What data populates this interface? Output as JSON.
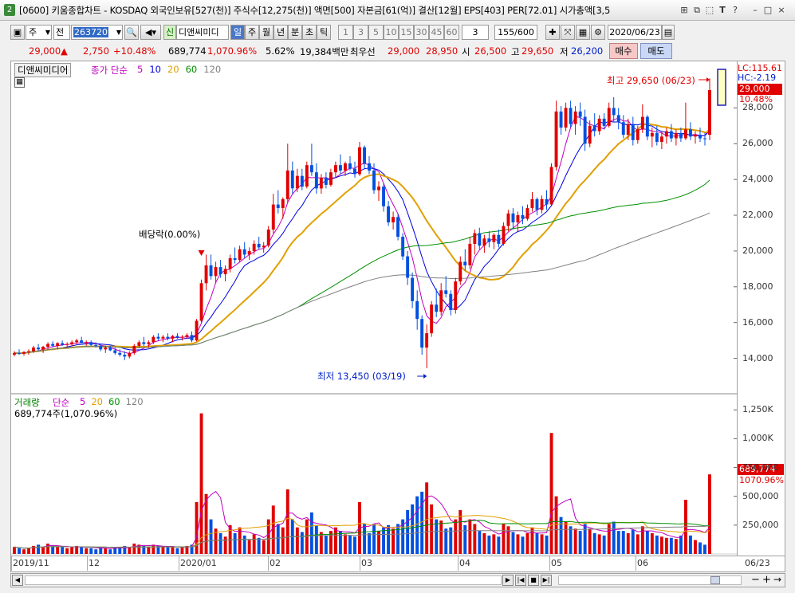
{
  "window": {
    "number": "2",
    "title": "[0600] 키움종합차트 - KOSDAQ 외국인보유[527(천)] 주식수[12,275(천)] 액면[500] 자본금[61(억)] 결산[12월] EPS[403] PER[72.01] 시가총액[3,5"
  },
  "toolbar": {
    "period_select": "주",
    "type_select": "전",
    "stock_code": "263720",
    "credit_badge": "신",
    "stock_name": "디앤씨미디",
    "periods": [
      "일",
      "주",
      "월",
      "년",
      "분",
      "초",
      "틱"
    ],
    "active_period": "일",
    "intervals": [
      "1",
      "3",
      "5",
      "10",
      "15",
      "30",
      "45",
      "60"
    ],
    "interval_value": "3",
    "count": "155/600",
    "date": "2020/06/23"
  },
  "info": {
    "price": "29,000",
    "change_arrow": "▲",
    "change": "2,750",
    "change_pct": "+10.48%",
    "volume": "689,774",
    "volume_pct": "1,070.96%",
    "turnover": "5.62%",
    "amount": "19,384백만",
    "best_label": "최우선",
    "ask": "29,000",
    "bid": "28,950",
    "open_label": "시",
    "open": "26,500",
    "high_label": "고",
    "high": "29,650",
    "low_label": "저",
    "low": "26,200",
    "buy_button": "매수",
    "sell_button": "매도"
  },
  "price_panel": {
    "stock_label": "디앤씨미디어",
    "ma_label": "종가 단순",
    "ma_periods": [
      "5",
      "10",
      "20",
      "60",
      "120"
    ],
    "ma_colors": [
      "#c000c0",
      "#0000e0",
      "#e0a000",
      "#009000",
      "#808080"
    ],
    "lc_label": "LC:115.61",
    "hc_label": "HC:-2.19",
    "current_price_tag": "29,000",
    "current_pct_tag": "10.48%",
    "high_annotation": "최고 29,650 (06/23)",
    "low_annotation": "최저 13,450 (03/19)",
    "dividend_annotation": "배당락(0.00%)",
    "y_ticks": [
      "28,000",
      "26,000",
      "24,000",
      "22,000",
      "20,000",
      "18,000",
      "16,000",
      "14,000"
    ]
  },
  "volume_panel": {
    "label": "거래량",
    "ma_label": "단순",
    "ma_periods": [
      "5",
      "20",
      "60",
      "120"
    ],
    "current_label": "689,774주(1,070.96%)",
    "y_ticks": [
      "1,250K",
      "1,000K",
      "750,000",
      "500,000",
      "250,000"
    ],
    "current_tag": "689,774",
    "current_pct_tag": "1070.96%"
  },
  "x_axis": {
    "labels": [
      "2019/11",
      "12",
      "2020/01",
      "02",
      "03",
      "04",
      "05",
      "06"
    ],
    "end_label": "06/23"
  },
  "chart_data": {
    "type": "candlestick",
    "summary": {
      "high": 29650,
      "high_date": "06/23",
      "low": 13450,
      "low_date": "03/19",
      "last_close": 29000,
      "last_open": 26500,
      "last_high": 29650,
      "last_low": 26200,
      "last_volume": 689774
    },
    "ylim": [
      13000,
      29800
    ],
    "volume_ylim": [
      0,
      1300000
    ],
    "candles": [
      [
        14200,
        14400,
        14100,
        14300,
        60
      ],
      [
        14300,
        14500,
        14200,
        14250,
        50
      ],
      [
        14250,
        14400,
        14150,
        14350,
        40
      ],
      [
        14350,
        14500,
        14200,
        14400,
        55
      ],
      [
        14400,
        14700,
        14300,
        14600,
        70
      ],
      [
        14600,
        14800,
        14400,
        14500,
        80
      ],
      [
        14500,
        14700,
        14300,
        14650,
        60
      ],
      [
        14650,
        14900,
        14500,
        14800,
        90
      ],
      [
        14800,
        14950,
        14600,
        14700,
        70
      ],
      [
        14700,
        14900,
        14500,
        14850,
        60
      ],
      [
        14850,
        15000,
        14700,
        14750,
        60
      ],
      [
        14750,
        14900,
        14600,
        14800,
        50
      ],
      [
        14800,
        15000,
        14700,
        14900,
        60
      ],
      [
        14900,
        15100,
        14800,
        15000,
        70
      ],
      [
        15000,
        15200,
        14850,
        14850,
        60
      ],
      [
        14850,
        15000,
        14700,
        14900,
        50
      ],
      [
        14900,
        15000,
        14700,
        14750,
        50
      ],
      [
        14750,
        14900,
        14600,
        14700,
        40
      ],
      [
        14700,
        14800,
        14400,
        14500,
        60
      ],
      [
        14500,
        14700,
        14300,
        14600,
        50
      ],
      [
        14600,
        14700,
        14400,
        14450,
        40
      ],
      [
        14450,
        14600,
        14200,
        14300,
        60
      ],
      [
        14300,
        14500,
        14100,
        14200,
        50
      ],
      [
        14200,
        14400,
        13900,
        14100,
        70
      ],
      [
        14100,
        14400,
        14000,
        14300,
        60
      ],
      [
        14300,
        14800,
        14200,
        14700,
        90
      ],
      [
        14700,
        15000,
        14600,
        14900,
        80
      ],
      [
        14900,
        15200,
        14700,
        14800,
        70
      ],
      [
        14800,
        15000,
        14600,
        14900,
        60
      ],
      [
        14900,
        15300,
        14800,
        15200,
        80
      ],
      [
        15200,
        15400,
        15000,
        15100,
        70
      ],
      [
        15100,
        15300,
        14900,
        15200,
        60
      ],
      [
        15200,
        15400,
        15000,
        15100,
        60
      ],
      [
        15100,
        15300,
        14900,
        15250,
        60
      ],
      [
        15250,
        15400,
        15100,
        15150,
        50
      ],
      [
        15150,
        15300,
        15000,
        15200,
        60
      ],
      [
        15200,
        15400,
        15100,
        15300,
        70
      ],
      [
        15300,
        15500,
        14900,
        15000,
        80
      ],
      [
        15000,
        16200,
        14950,
        16100,
        450
      ],
      [
        16100,
        18400,
        16000,
        18200,
        1220
      ],
      [
        18200,
        19800,
        17800,
        19200,
        520
      ],
      [
        19200,
        19800,
        18400,
        18600,
        300
      ],
      [
        18600,
        19400,
        18200,
        19100,
        220
      ],
      [
        19100,
        19500,
        18500,
        18700,
        180
      ],
      [
        18700,
        19200,
        18300,
        19000,
        150
      ],
      [
        19000,
        19800,
        18800,
        19600,
        250
      ],
      [
        19600,
        20200,
        19300,
        19500,
        180
      ],
      [
        19500,
        20300,
        19400,
        20100,
        230
      ],
      [
        20100,
        20500,
        19600,
        19800,
        160
      ],
      [
        19800,
        20200,
        19500,
        20000,
        120
      ],
      [
        20000,
        20600,
        19800,
        20400,
        170
      ],
      [
        20400,
        20800,
        20100,
        20200,
        140
      ],
      [
        20200,
        20500,
        19900,
        20300,
        120
      ],
      [
        20300,
        21400,
        20200,
        21200,
        300
      ],
      [
        21200,
        23200,
        21000,
        22600,
        420
      ],
      [
        22600,
        23400,
        22100,
        22400,
        260
      ],
      [
        22400,
        23000,
        21800,
        22900,
        230
      ],
      [
        22900,
        26000,
        22700,
        24500,
        560
      ],
      [
        24500,
        25000,
        23200,
        23500,
        300
      ],
      [
        23500,
        24600,
        23300,
        24200,
        230
      ],
      [
        24200,
        24600,
        23400,
        23600,
        190
      ],
      [
        23600,
        25000,
        23500,
        24800,
        300
      ],
      [
        24800,
        26000,
        24200,
        24400,
        360
      ],
      [
        24400,
        24900,
        23200,
        23500,
        250
      ],
      [
        23500,
        24300,
        23200,
        24100,
        190
      ],
      [
        24100,
        24400,
        23500,
        23700,
        160
      ],
      [
        23700,
        24600,
        23600,
        24400,
        200
      ],
      [
        24400,
        25000,
        24100,
        24800,
        230
      ],
      [
        24800,
        25400,
        24300,
        24500,
        200
      ],
      [
        24500,
        25000,
        24200,
        24900,
        170
      ],
      [
        24900,
        25300,
        24500,
        24600,
        160
      ],
      [
        24600,
        25000,
        24100,
        24300,
        150
      ],
      [
        24300,
        26100,
        24200,
        25800,
        450
      ],
      [
        25800,
        25900,
        24600,
        24900,
        260
      ],
      [
        24900,
        25300,
        24300,
        24500,
        180
      ],
      [
        24500,
        24900,
        23200,
        23400,
        260
      ],
      [
        23400,
        23900,
        22800,
        23600,
        200
      ],
      [
        23600,
        23800,
        22200,
        22500,
        230
      ],
      [
        22500,
        22800,
        21400,
        21600,
        250
      ],
      [
        21600,
        22200,
        21200,
        21900,
        220
      ],
      [
        21900,
        22100,
        20600,
        20800,
        260
      ],
      [
        20800,
        21000,
        19500,
        19700,
        300
      ],
      [
        19700,
        20000,
        18100,
        18500,
        380
      ],
      [
        18500,
        18800,
        16800,
        17200,
        430
      ],
      [
        17200,
        17800,
        15600,
        16200,
        500
      ],
      [
        16200,
        16400,
        14200,
        14600,
        540
      ],
      [
        14600,
        15900,
        13450,
        15400,
        620
      ],
      [
        15400,
        17200,
        15200,
        17000,
        430
      ],
      [
        17000,
        17900,
        16300,
        16600,
        300
      ],
      [
        16600,
        18200,
        16400,
        17800,
        290
      ],
      [
        17800,
        18600,
        17400,
        17600,
        220
      ],
      [
        17600,
        17800,
        16400,
        16700,
        230
      ],
      [
        16700,
        18500,
        16500,
        18300,
        300
      ],
      [
        18300,
        19700,
        18100,
        19400,
        380
      ],
      [
        19400,
        20100,
        18900,
        19200,
        250
      ],
      [
        19200,
        20800,
        19000,
        20400,
        300
      ],
      [
        20400,
        21200,
        19800,
        21000,
        260
      ],
      [
        21000,
        21300,
        20100,
        20300,
        200
      ],
      [
        20300,
        20900,
        19900,
        20700,
        180
      ],
      [
        20700,
        21100,
        20200,
        20500,
        160
      ],
      [
        20500,
        21000,
        20100,
        20900,
        170
      ],
      [
        20900,
        21200,
        20200,
        20400,
        150
      ],
      [
        20400,
        21600,
        20300,
        21400,
        260
      ],
      [
        21400,
        22300,
        21100,
        22100,
        240
      ],
      [
        22100,
        22400,
        21200,
        21600,
        190
      ],
      [
        21600,
        22200,
        21100,
        22000,
        170
      ],
      [
        22000,
        22500,
        21500,
        21800,
        150
      ],
      [
        21800,
        22600,
        21700,
        22400,
        180
      ],
      [
        22400,
        23300,
        22200,
        22900,
        230
      ],
      [
        22900,
        23000,
        22000,
        22300,
        180
      ],
      [
        22300,
        23100,
        22100,
        22900,
        170
      ],
      [
        22900,
        23400,
        22300,
        22600,
        160
      ],
      [
        22600,
        24900,
        22500,
        24700,
        1050
      ],
      [
        24700,
        28400,
        24500,
        27800,
        500
      ],
      [
        27800,
        28100,
        26500,
        26900,
        320
      ],
      [
        26900,
        28300,
        26700,
        28000,
        280
      ],
      [
        28000,
        28400,
        26900,
        27100,
        240
      ],
      [
        27100,
        28100,
        26500,
        27800,
        220
      ],
      [
        27800,
        28300,
        27000,
        27500,
        200
      ],
      [
        27500,
        27900,
        25600,
        26000,
        260
      ],
      [
        26000,
        27300,
        25800,
        27000,
        220
      ],
      [
        27000,
        27700,
        26400,
        26700,
        180
      ],
      [
        26700,
        27600,
        26500,
        27400,
        170
      ],
      [
        27400,
        27700,
        26800,
        27000,
        160
      ],
      [
        27000,
        28300,
        26900,
        28000,
        260
      ],
      [
        28000,
        28600,
        27200,
        27600,
        280
      ],
      [
        27600,
        28000,
        26800,
        27200,
        200
      ],
      [
        27200,
        27600,
        26300,
        26500,
        200
      ],
      [
        26500,
        27400,
        26200,
        27100,
        180
      ],
      [
        27100,
        27500,
        25900,
        26200,
        210
      ],
      [
        26200,
        27000,
        26000,
        26800,
        170
      ],
      [
        26800,
        28200,
        26600,
        27500,
        240
      ],
      [
        27500,
        27600,
        26200,
        26400,
        200
      ],
      [
        26400,
        26900,
        25800,
        26600,
        180
      ],
      [
        26600,
        27000,
        25900,
        26100,
        160
      ],
      [
        26100,
        26700,
        25700,
        26400,
        150
      ],
      [
        26400,
        26900,
        26000,
        26700,
        140
      ],
      [
        26700,
        27100,
        26100,
        26300,
        140
      ],
      [
        26300,
        26800,
        25900,
        26600,
        130
      ],
      [
        26600,
        26900,
        26100,
        26300,
        160
      ],
      [
        26300,
        28300,
        26200,
        26800,
        470
      ],
      [
        26800,
        27200,
        26200,
        26400,
        160
      ],
      [
        26400,
        26700,
        26000,
        26500,
        120
      ],
      [
        26500,
        26900,
        26100,
        26300,
        100
      ],
      [
        26300,
        26600,
        25900,
        26250,
        80
      ],
      [
        26500,
        29650,
        26200,
        29000,
        690
      ]
    ]
  }
}
